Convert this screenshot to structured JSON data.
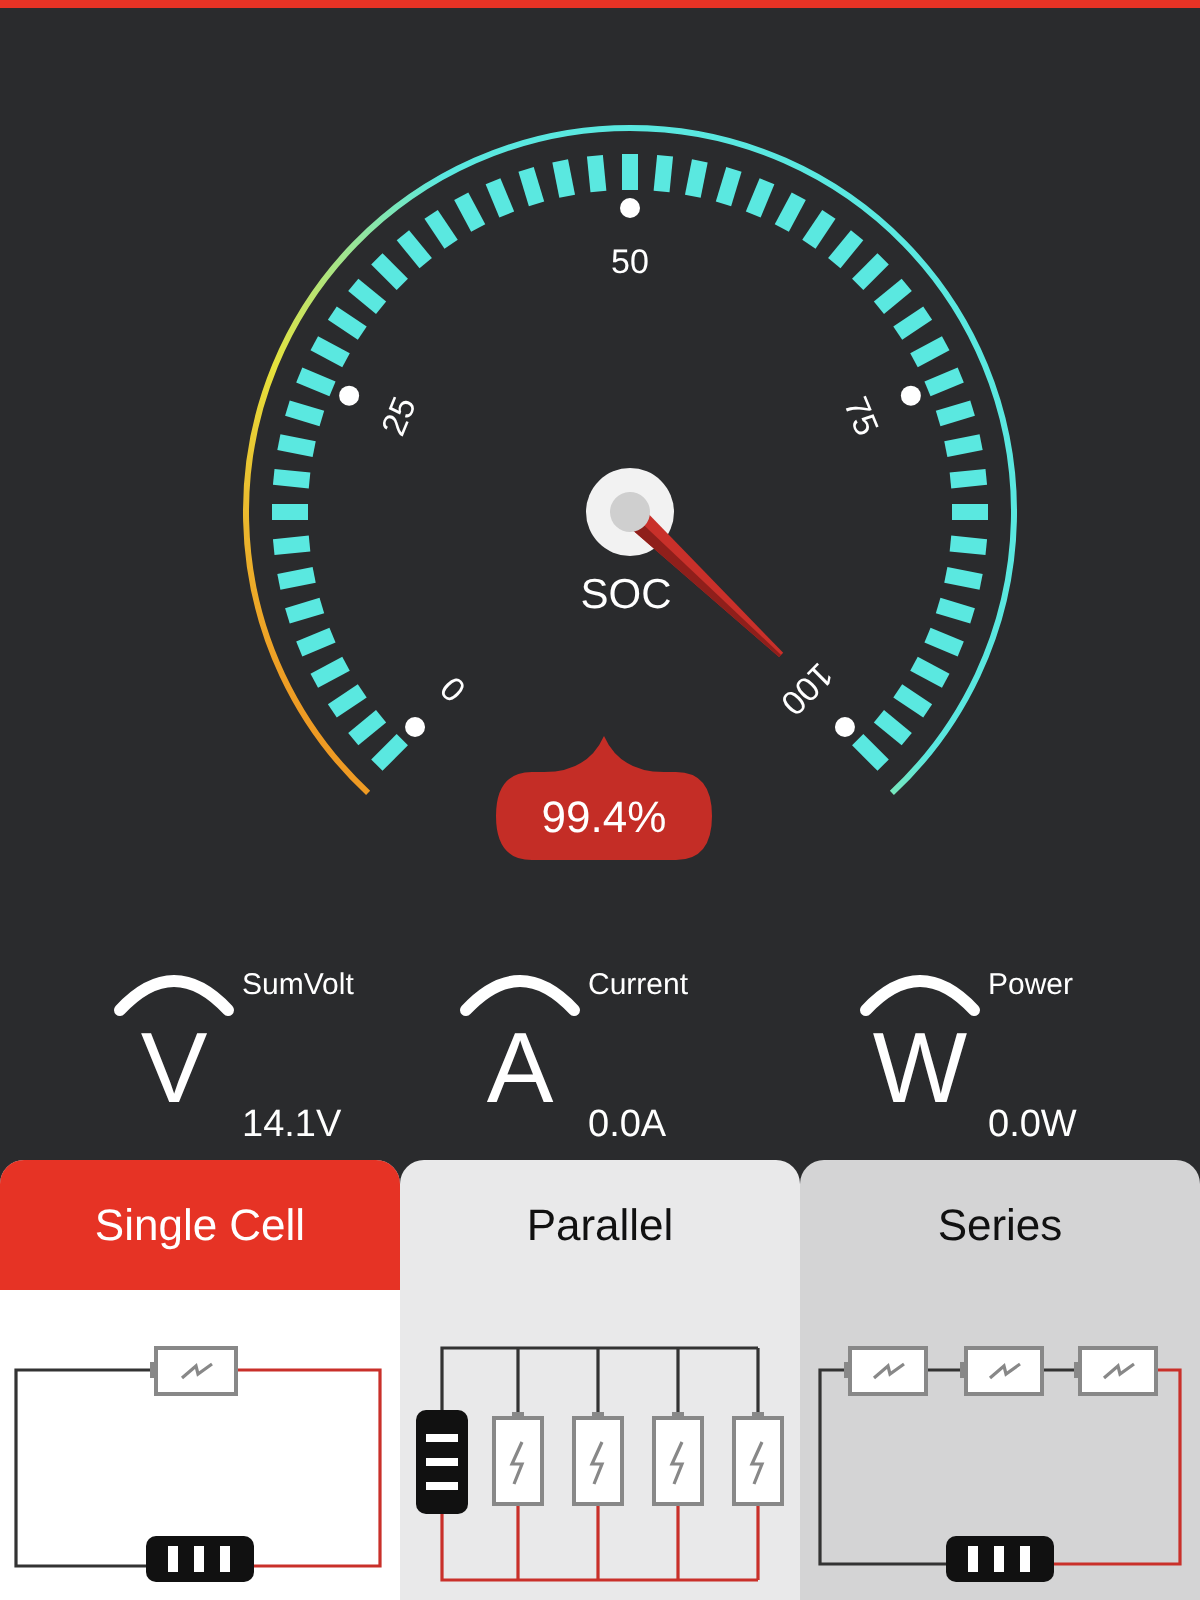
{
  "gauge": {
    "label": "SOC",
    "reading": "99.4%",
    "scale_labels": [
      "0",
      "25",
      "50",
      "75",
      "100"
    ]
  },
  "metrics": [
    {
      "symbol": "V",
      "label": "SumVolt",
      "value": "14.1V"
    },
    {
      "symbol": "A",
      "label": "Current",
      "value": "0.0A"
    },
    {
      "symbol": "W",
      "label": "Power",
      "value": "0.0W"
    }
  ],
  "tabs": [
    {
      "label": "Single Cell",
      "selected": true,
      "kind": "single"
    },
    {
      "label": "Parallel",
      "selected": false,
      "kind": "parallel"
    },
    {
      "label": "Series",
      "selected": false,
      "kind": "series"
    }
  ]
}
